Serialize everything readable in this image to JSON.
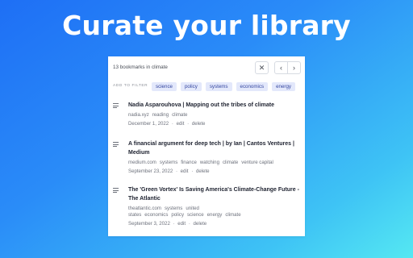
{
  "headline": "Curate your library",
  "panel": {
    "count_text": "13 bookmarks in climate",
    "close_glyph": "✕",
    "prev_glyph": "‹",
    "next_glyph": "›",
    "filter_label": "ADD TO FILTER",
    "filter_chips": [
      "science",
      "policy",
      "systems",
      "economics",
      "energy"
    ],
    "bookmarks": [
      {
        "title": "Nadia Asparouhova | Mapping out the tribes of climate",
        "tags": [
          "nadia.xyz",
          "reading",
          "climate"
        ],
        "date": "December 1, 2022",
        "edit": "edit",
        "delete": "delete",
        "sep": "·"
      },
      {
        "title": "A financial argument for deep tech | by Ian | Cantos Ventures | Medium",
        "tags": [
          "medium.com",
          "systems",
          "finance",
          "watching",
          "climate",
          "venture capital"
        ],
        "date": "September 23, 2022",
        "edit": "edit",
        "delete": "delete",
        "sep": "·"
      },
      {
        "title": "The 'Green Vortex' Is Saving America's Climate-Change Future - The Atlantic",
        "tags": [
          "theatlantic.com",
          "systems",
          "united states",
          "economics",
          "policy",
          "science",
          "energy",
          "climate"
        ],
        "date": "September 3, 2022",
        "edit": "edit",
        "delete": "delete",
        "sep": "·"
      }
    ]
  }
}
